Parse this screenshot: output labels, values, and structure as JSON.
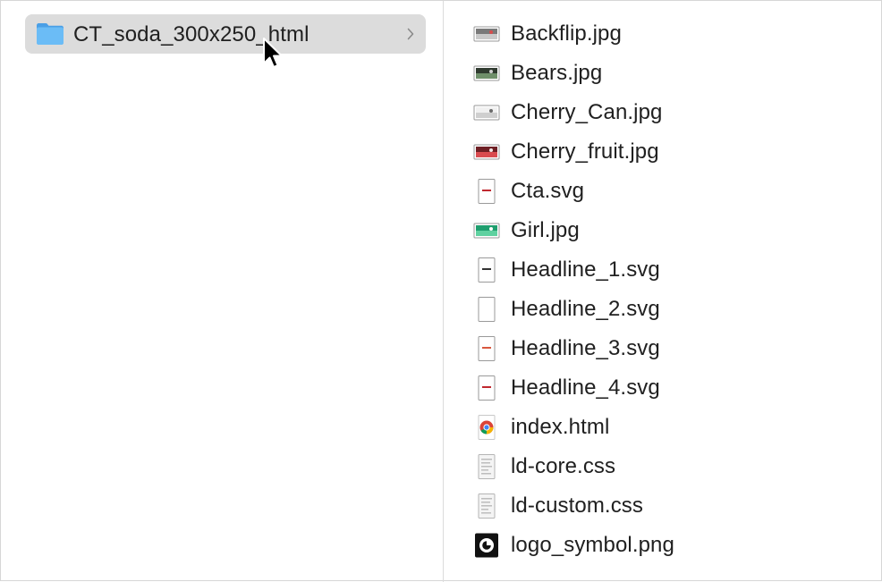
{
  "window": {
    "folder_item": {
      "label": "CT_soda_300x250_html",
      "icon": "folder-icon",
      "color": "#5aaef0"
    },
    "files": [
      {
        "name": "Backflip.jpg",
        "icon": "image-thumbnail-icon"
      },
      {
        "name": "Bears.jpg",
        "icon": "image-thumbnail-icon"
      },
      {
        "name": "Cherry_Can.jpg",
        "icon": "image-thumbnail-icon"
      },
      {
        "name": "Cherry_fruit.jpg",
        "icon": "image-thumbnail-icon"
      },
      {
        "name": "Cta.svg",
        "icon": "svg-document-icon"
      },
      {
        "name": "Girl.jpg",
        "icon": "image-thumbnail-icon"
      },
      {
        "name": "Headline_1.svg",
        "icon": "svg-document-icon"
      },
      {
        "name": "Headline_2.svg",
        "icon": "svg-document-icon"
      },
      {
        "name": "Headline_3.svg",
        "icon": "svg-document-icon"
      },
      {
        "name": "Headline_4.svg",
        "icon": "svg-document-icon"
      },
      {
        "name": "index.html",
        "icon": "chrome-html-icon"
      },
      {
        "name": "ld-core.css",
        "icon": "css-document-icon"
      },
      {
        "name": "ld-custom.css",
        "icon": "css-document-icon"
      },
      {
        "name": "logo_symbol.png",
        "icon": "png-logo-icon"
      }
    ],
    "selection_color": "#dcdcdc"
  }
}
